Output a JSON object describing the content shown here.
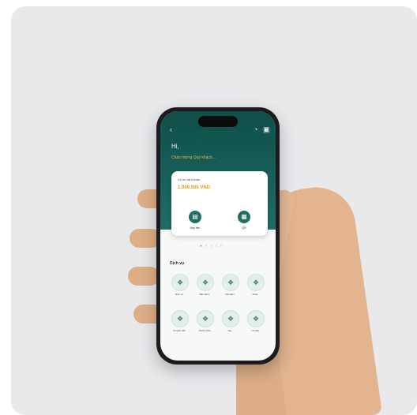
{
  "app": {
    "greeting": "Hi,",
    "marquee": "Chào mừng Quý khách...",
    "balance_label": "Số dư tài khoản",
    "balance_value": "1.000.000 VND",
    "actions": [
      {
        "icon": "card-icon",
        "label": "Nạp tiền"
      },
      {
        "icon": "qr-icon",
        "label": "QR"
      }
    ],
    "pager_dots": "● ○ ○ ○ ○",
    "services_title": "Dịch vụ",
    "services": [
      {
        "icon": "service-icon",
        "label": "Dịch vụ"
      },
      {
        "icon": "service-icon",
        "label": "Bảo hiểm"
      },
      {
        "icon": "service-icon",
        "label": "Tiết kiệm"
      },
      {
        "icon": "service-icon",
        "label": "Khác"
      },
      {
        "icon": "service-icon",
        "label": "Chuyển tiền"
      },
      {
        "icon": "service-icon",
        "label": "Thanh toán"
      },
      {
        "icon": "service-icon",
        "label": "Vay"
      },
      {
        "icon": "service-icon",
        "label": "Ưu đãi"
      }
    ]
  },
  "colors": {
    "brand": "#1f6e66",
    "accent": "#e39b17",
    "background": "#e9e9ec"
  }
}
